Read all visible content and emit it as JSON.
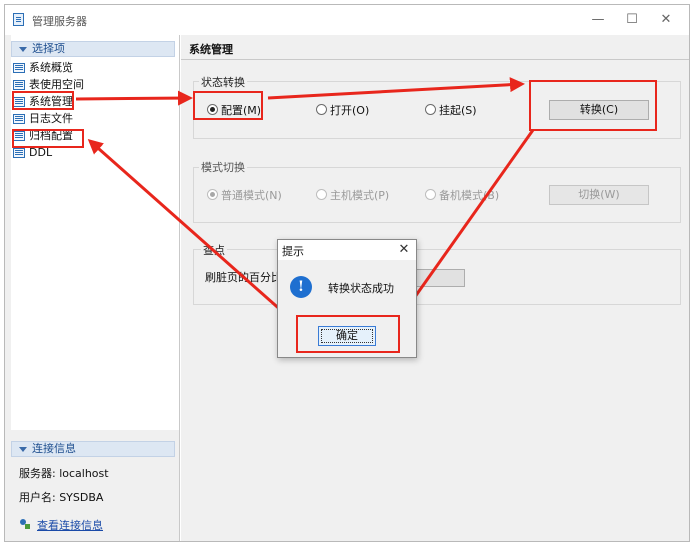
{
  "window": {
    "title": "管理服务器",
    "minimize": "—",
    "maximize": "☐",
    "close": "✕"
  },
  "sidebar": {
    "options_header": "选择项",
    "items": [
      {
        "label": "系统概览"
      },
      {
        "label": "表使用空间"
      },
      {
        "label": "系统管理"
      },
      {
        "label": "日志文件"
      },
      {
        "label": "归档配置"
      },
      {
        "label": "DDL"
      }
    ],
    "connection_header": "连接信息",
    "server_line": "服务器: localhost",
    "user_line": "用户名: SYSDBA",
    "view_link": "查看连接信息"
  },
  "main": {
    "title": "系统管理",
    "state_group": {
      "title": "状态转换",
      "options": [
        "配置(M)",
        "打开(O)",
        "挂起(S)"
      ],
      "selected_index": 0,
      "button": "转换(C)"
    },
    "mode_group": {
      "title": "模式切换",
      "options": [
        "普通模式(N)",
        "主机模式(P)",
        "备机模式(B)"
      ],
      "selected_index": 0,
      "button": "切换(W)"
    },
    "checkpoint_group": {
      "title_visible": "查点",
      "label_visible": "刷脏页的百分比("
    }
  },
  "dialog": {
    "title": "提示",
    "close": "✕",
    "icon": "info-icon",
    "message": "转换状态成功",
    "ok": "确定"
  },
  "colors": {
    "annotation_red": "#e8261c",
    "info_blue": "#1e6fd0",
    "link_blue": "#1a4aa8",
    "header_bg": "#dde7f3"
  }
}
